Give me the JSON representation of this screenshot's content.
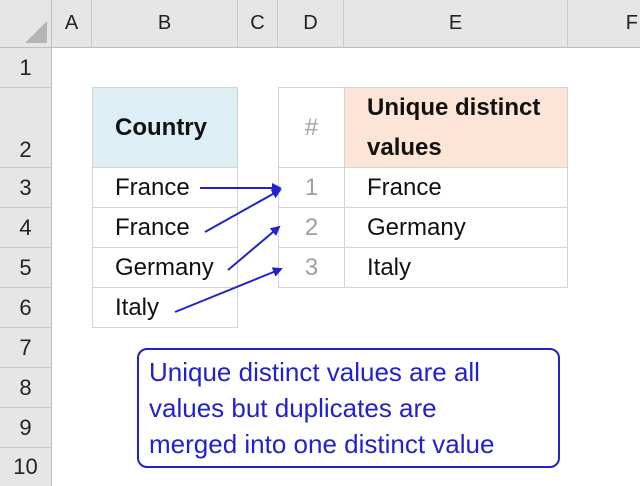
{
  "columns": [
    "A",
    "B",
    "C",
    "D",
    "E",
    "F"
  ],
  "rows": [
    "1",
    "2",
    "3",
    "4",
    "5",
    "6",
    "7",
    "8",
    "9",
    "10"
  ],
  "source": {
    "header": "Country",
    "values": [
      "France",
      "France",
      "Germany",
      "Italy"
    ]
  },
  "result": {
    "num_header": "#",
    "header_line1": "Unique distinct",
    "header_line2": "values",
    "numbers": [
      "1",
      "2",
      "3"
    ],
    "values": [
      "France",
      "Germany",
      "Italy"
    ]
  },
  "note": {
    "line1": "Unique distinct values are all",
    "line2": "values but duplicates are",
    "line3": "merged into one distinct value"
  },
  "colors": {
    "arrow": "#2222cc",
    "country_header_fill": "#deeef5",
    "unique_header_fill": "#fce4d6",
    "header_gray": "#e6e6e6"
  }
}
